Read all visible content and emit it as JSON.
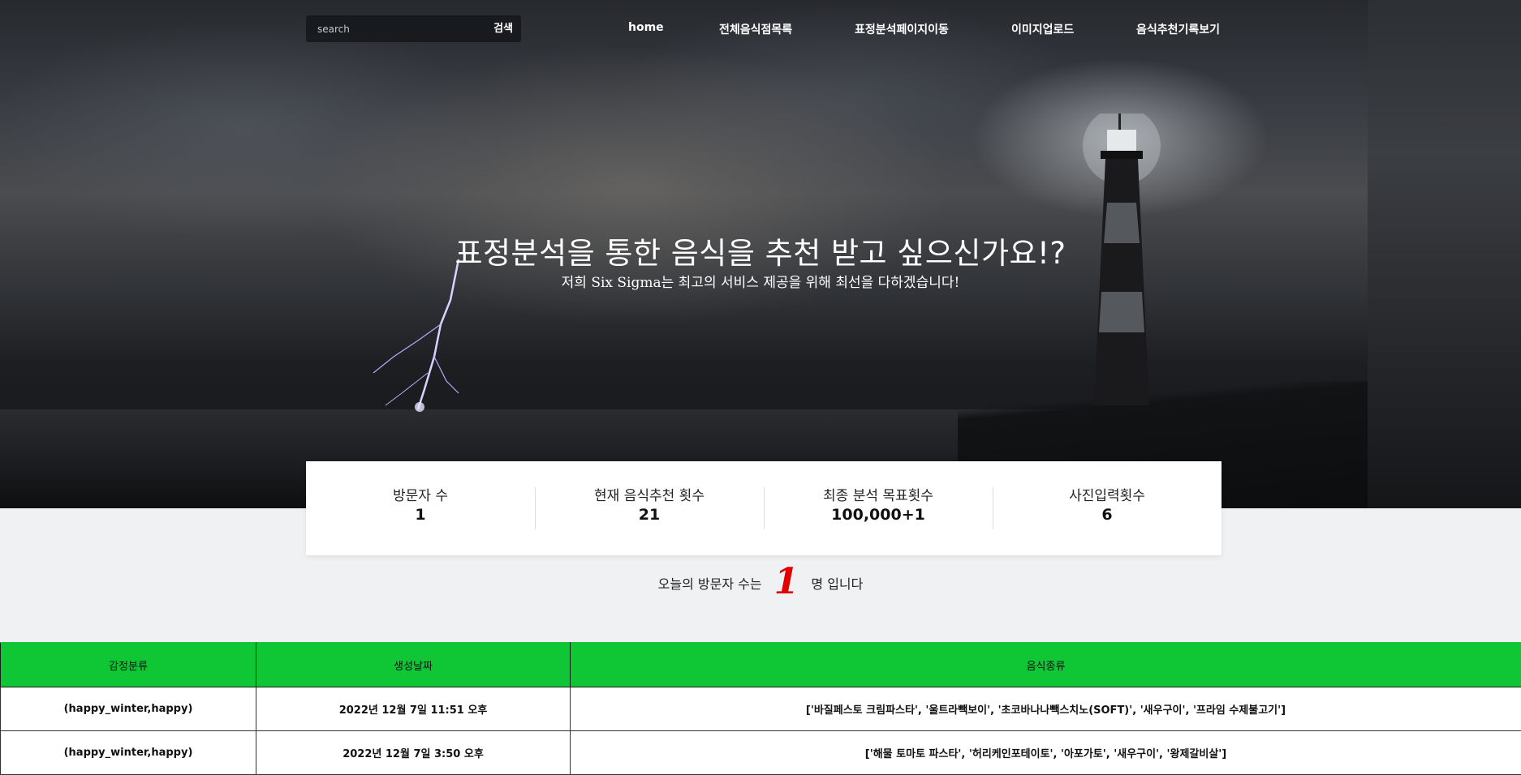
{
  "search": {
    "placeholder": "search",
    "button_label": "검색"
  },
  "nav": {
    "home": "home",
    "food_list": "전체음식점목록",
    "expression_page": "표정분석페이지이동",
    "image_upload": "이미지업로드",
    "history": "음식추천기록보기"
  },
  "hero": {
    "title": "표정분석을 통한 음식을 추천 받고 싶으신가요!?",
    "subtitle": "저희 Six Sigma는 최고의 서비스 제공을 위해 최선을 다하겠습니다!"
  },
  "stats": [
    {
      "label": "방문자 수",
      "value": "1"
    },
    {
      "label": "현재 음식추천 횟수",
      "value": "21"
    },
    {
      "label": "최종 분석 목표횟수",
      "value": "100,000+1"
    },
    {
      "label": "사진입력횟수",
      "value": "6"
    }
  ],
  "visitor": {
    "prefix": "오늘의 방문자 수는",
    "count": "1",
    "suffix": "명 입니다"
  },
  "table": {
    "headers": [
      "감정분류",
      "생성날짜",
      "음식종류"
    ],
    "rows": [
      [
        "(happy_winter,happy)",
        "2022년 12월 7일 11:51 오후",
        "['바질페스토 크림파스타', '울트라빽보이', '초코바나나빽스치노(SOFT)', '새우구이', '프라임 수제불고기']"
      ],
      [
        "(happy_winter,happy)",
        "2022년 12월 7일 3:50 오후",
        "['해물 토마토 파스타', '허리케인포테이토', '아포가토', '새우구이', '왕제갈비살']"
      ]
    ]
  },
  "colors": {
    "accent_green": "#0fc734",
    "visitor_red": "#e00000"
  }
}
